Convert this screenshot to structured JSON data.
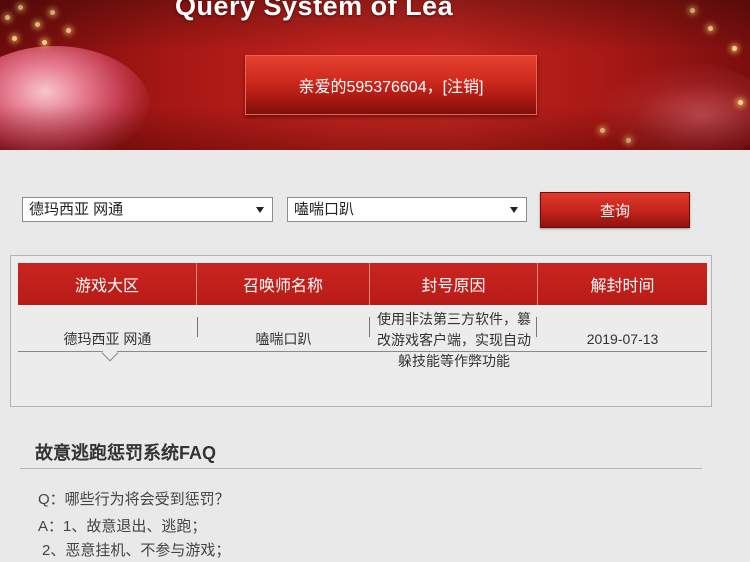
{
  "banner": {
    "title": "Query System of Lea",
    "greeting": "亲爱的595376604，",
    "logout_label": "[注销]"
  },
  "query_form": {
    "region_select": {
      "value": "德玛西亚 网通",
      "icon": "caret-down-icon"
    },
    "summoner_select": {
      "value": "嗑喘口趴",
      "icon": "caret-down-icon"
    },
    "submit_label": "查询"
  },
  "results_table": {
    "columns": [
      "游戏大区",
      "召唤师名称",
      "封号原因",
      "解封时间"
    ],
    "rows": [
      [
        "德玛西亚 网通",
        "嗑喘口趴",
        "使用非法第三方软件，篡改游戏客户端，实现自动躲技能等作弊功能",
        "2019-07-13"
      ]
    ]
  },
  "faq": {
    "title": "故意逃跑惩罚系统FAQ",
    "lines": [
      "Q：哪些行为将会受到惩罚？",
      "A：1、故意退出、逃跑；",
      "2、恶意挂机、不参与游戏；"
    ]
  },
  "colors": {
    "banner_red": "#c3231e",
    "button_red": "#c2231a",
    "table_header_red": "#bf211b",
    "page_background": "#e9e9e9"
  }
}
